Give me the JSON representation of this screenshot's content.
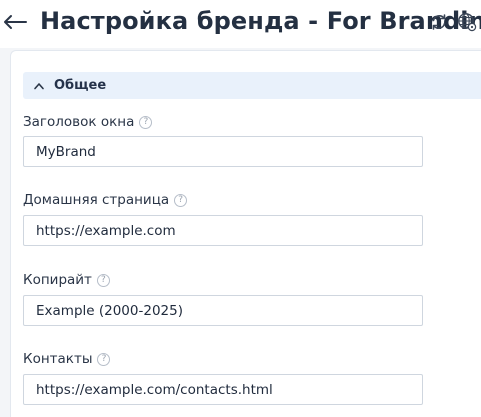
{
  "header": {
    "title": "Настройка бренда - For Branding",
    "back_icon": "arrow-left-icon",
    "refresh_icon": "refresh-icon",
    "language_icon": "globe-icon"
  },
  "section": {
    "label": "Общее",
    "expanded": true
  },
  "fields": [
    {
      "label": "Заголовок окна",
      "help": "?",
      "value": "MyBrand"
    },
    {
      "label": "Домашняя страница",
      "help": "?",
      "value": "https://example.com"
    },
    {
      "label": "Копирайт",
      "help": "?",
      "value": "Example (2000-2025)"
    },
    {
      "label": "Контакты",
      "help": "?",
      "value": "https://example.com/contacts.html"
    }
  ]
}
